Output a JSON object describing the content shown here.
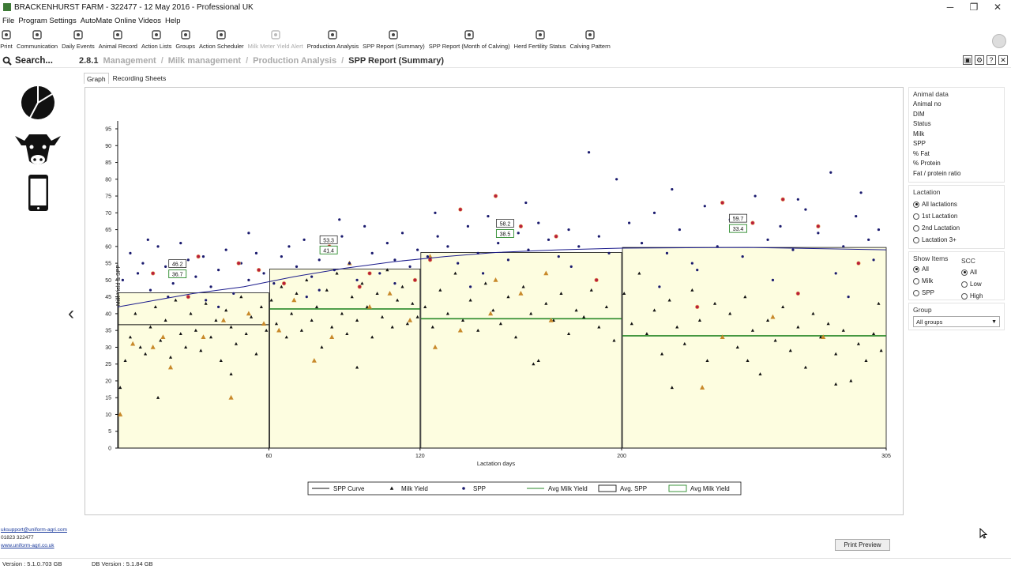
{
  "window": {
    "title": "BRACKENHURST FARM - 322477 - 12 May 2016 - Professional UK",
    "minimize": "─",
    "restore": "❐",
    "close": "✕"
  },
  "menu": [
    "File",
    "Program Settings",
    "AutoMate Online Videos",
    "Help"
  ],
  "toolbar": [
    {
      "label": "Print",
      "icon": "printer-icon",
      "disabled": false
    },
    {
      "label": "Communication",
      "icon": "antenna-icon",
      "disabled": false
    },
    {
      "label": "Daily Events",
      "icon": "monitor-icon",
      "disabled": false
    },
    {
      "label": "Animal Record",
      "icon": "cow-icon",
      "disabled": false
    },
    {
      "label": "Action Lists",
      "icon": "alert-icon",
      "disabled": false
    },
    {
      "label": "Groups",
      "icon": "group-icon",
      "disabled": false
    },
    {
      "label": "Action Scheduler",
      "icon": "stopwatch-icon",
      "disabled": false
    },
    {
      "label": "Milk Meter Yield Alert",
      "icon": "meter-icon",
      "disabled": true
    },
    {
      "label": "Production Analysis",
      "icon": "analysis-icon",
      "disabled": false
    },
    {
      "label": "SPP Report (Summary)",
      "icon": "report-icon",
      "disabled": false
    },
    {
      "label": "SPP Report (Month of Calving)",
      "icon": "report-month-icon",
      "disabled": false
    },
    {
      "label": "Herd Fertility Status",
      "icon": "fertility-icon",
      "disabled": false
    },
    {
      "label": "Calving Pattern",
      "icon": "calving-icon",
      "disabled": false
    }
  ],
  "search": {
    "label": "Search..."
  },
  "breadcrumb": {
    "number": "2.8.1",
    "items": [
      "Management",
      "Milk management",
      "Production Analysis",
      "SPP Report (Summary)"
    ]
  },
  "tabs": [
    {
      "label": "Graph",
      "active": true
    },
    {
      "label": "Recording Sheets",
      "active": false
    }
  ],
  "right_panel": {
    "animal_data": {
      "title": "Animal data",
      "fields": [
        "Animal no",
        "DIM",
        "Status",
        "Milk",
        "SPP",
        "% Fat",
        "% Protein",
        "Fat / protein ratio"
      ]
    },
    "lactation": {
      "title": "Lactation",
      "options": [
        "All lactations",
        "1st Lactation",
        "2nd Lactation",
        "Lactation 3+"
      ],
      "selected": 0
    },
    "show_items": {
      "title": "Show Items",
      "options": [
        "All",
        "Milk",
        "SPP"
      ],
      "selected": 0
    },
    "scc": {
      "title": "SCC",
      "options": [
        "All",
        "Low",
        "High"
      ],
      "selected": 0
    },
    "group": {
      "title": "Group",
      "value": "All groups"
    }
  },
  "footer": {
    "email": "uksupport@uniform-agri.com",
    "phone": "01823 322477",
    "web": "www.uniform-agri.co.uk"
  },
  "status": {
    "version": "Version : 5.1.0.703 GB",
    "db_version": "DB Version : 5.1.84 GB"
  },
  "print_preview": "Print Preview",
  "colors": {
    "fill": "#fdfde0",
    "spp_curve": "#1c1c8c",
    "avg_milk": "#2a8a2a",
    "spp_dot": "#1a1a6e",
    "spp_high": "#b81e3c",
    "milk_tri": "#111111",
    "milk_tri_high": "#c8892a"
  },
  "chart_data": {
    "type": "scatter",
    "xlabel": "Lactation days",
    "ylabel": "Milk Yield & SPP",
    "xlim": [
      0,
      305
    ],
    "ylim": [
      0,
      95
    ],
    "x_ticks": [
      60,
      120,
      200,
      305
    ],
    "y_ticks": [
      0,
      5,
      10,
      15,
      20,
      25,
      30,
      35,
      40,
      45,
      50,
      55,
      60,
      65,
      70,
      75,
      80,
      85,
      90,
      95
    ],
    "periods": [
      {
        "start": 0,
        "end": 60,
        "avg_spp": 46.2,
        "avg_milk": 36.7,
        "avg_spp_label": "46.2",
        "avg_milk_label": "36.7"
      },
      {
        "start": 60,
        "end": 120,
        "avg_spp": 53.3,
        "avg_milk": 41.4,
        "avg_spp_label": "53.3",
        "avg_milk_label": "41.4"
      },
      {
        "start": 120,
        "end": 200,
        "avg_spp": 58.2,
        "avg_milk": 38.5,
        "avg_spp_label": "58.2",
        "avg_milk_label": "38.5"
      },
      {
        "start": 200,
        "end": 305,
        "avg_spp": 59.7,
        "avg_milk": 33.4,
        "avg_spp_label": "59.7",
        "avg_milk_label": "33.4"
      }
    ],
    "spp_curve": [
      [
        0,
        42
      ],
      [
        15,
        44
      ],
      [
        30,
        46
      ],
      [
        50,
        48
      ],
      [
        70,
        51
      ],
      [
        90,
        53.5
      ],
      [
        110,
        55.5
      ],
      [
        130,
        57
      ],
      [
        150,
        58.2
      ],
      [
        175,
        59
      ],
      [
        200,
        59.5
      ],
      [
        250,
        59.7
      ],
      [
        305,
        59
      ]
    ],
    "legend": [
      "SPP Curve",
      "Milk Yield",
      "SPP",
      "Avg Milk Yield",
      "Avg. SPP",
      "Avg Milk Yield"
    ],
    "spp_points": [
      [
        2,
        50
      ],
      [
        5,
        58
      ],
      [
        8,
        52
      ],
      [
        10,
        55
      ],
      [
        13,
        47
      ],
      [
        16,
        60
      ],
      [
        19,
        54
      ],
      [
        22,
        49
      ],
      [
        25,
        61
      ],
      [
        28,
        56
      ],
      [
        31,
        51
      ],
      [
        34,
        57
      ],
      [
        37,
        48
      ],
      [
        40,
        53
      ],
      [
        43,
        59
      ],
      [
        46,
        46
      ],
      [
        49,
        55
      ],
      [
        52,
        50
      ],
      [
        55,
        58
      ],
      [
        58,
        52
      ],
      [
        62,
        49
      ],
      [
        65,
        57
      ],
      [
        68,
        60
      ],
      [
        71,
        54
      ],
      [
        74,
        62
      ],
      [
        77,
        51
      ],
      [
        80,
        56
      ],
      [
        83,
        59
      ],
      [
        86,
        53
      ],
      [
        89,
        63
      ],
      [
        92,
        55
      ],
      [
        95,
        50
      ],
      [
        98,
        66
      ],
      [
        101,
        58
      ],
      [
        104,
        52
      ],
      [
        107,
        61
      ],
      [
        110,
        56
      ],
      [
        113,
        64
      ],
      [
        116,
        54
      ],
      [
        119,
        59
      ],
      [
        123,
        57
      ],
      [
        127,
        63
      ],
      [
        131,
        60
      ],
      [
        135,
        55
      ],
      [
        139,
        66
      ],
      [
        143,
        58
      ],
      [
        147,
        69
      ],
      [
        151,
        61
      ],
      [
        155,
        56
      ],
      [
        159,
        64
      ],
      [
        163,
        59
      ],
      [
        167,
        67
      ],
      [
        171,
        62
      ],
      [
        175,
        57
      ],
      [
        179,
        65
      ],
      [
        183,
        60
      ],
      [
        187,
        88
      ],
      [
        191,
        63
      ],
      [
        195,
        58
      ],
      [
        198,
        80
      ],
      [
        203,
        67
      ],
      [
        208,
        61
      ],
      [
        213,
        70
      ],
      [
        218,
        58
      ],
      [
        223,
        65
      ],
      [
        228,
        55
      ],
      [
        233,
        72
      ],
      [
        238,
        60
      ],
      [
        243,
        68
      ],
      [
        248,
        57
      ],
      [
        253,
        75
      ],
      [
        258,
        62
      ],
      [
        263,
        66
      ],
      [
        268,
        59
      ],
      [
        273,
        71
      ],
      [
        278,
        64
      ],
      [
        283,
        82
      ],
      [
        288,
        60
      ],
      [
        293,
        69
      ],
      [
        298,
        62
      ],
      [
        302,
        65
      ],
      [
        20,
        45
      ],
      [
        40,
        42
      ],
      [
        80,
        47
      ],
      [
        110,
        49
      ],
      [
        145,
        52
      ],
      [
        180,
        54
      ],
      [
        215,
        48
      ],
      [
        260,
        50
      ],
      [
        290,
        45
      ],
      [
        300,
        56
      ],
      [
        12,
        62
      ],
      [
        52,
        64
      ],
      [
        88,
        68
      ],
      [
        126,
        70
      ],
      [
        162,
        73
      ],
      [
        220,
        77
      ],
      [
        270,
        74
      ],
      [
        295,
        76
      ],
      [
        35,
        44
      ],
      [
        75,
        45
      ],
      [
        140,
        48
      ],
      [
        230,
        53
      ],
      [
        285,
        52
      ]
    ],
    "spp_high_points": [
      [
        14,
        52
      ],
      [
        32,
        57
      ],
      [
        48,
        55
      ],
      [
        66,
        49
      ],
      [
        84,
        60
      ],
      [
        100,
        52
      ],
      [
        118,
        50
      ],
      [
        136,
        71
      ],
      [
        150,
        75
      ],
      [
        160,
        66
      ],
      [
        174,
        63
      ],
      [
        190,
        50
      ],
      [
        240,
        73
      ],
      [
        264,
        74
      ],
      [
        252,
        67
      ],
      [
        278,
        66
      ],
      [
        294,
        55
      ],
      [
        28,
        45
      ],
      [
        56,
        53
      ],
      [
        96,
        48
      ],
      [
        124,
        56
      ],
      [
        230,
        42
      ],
      [
        270,
        46
      ]
    ],
    "milk_points": [
      [
        1,
        18
      ],
      [
        3,
        26
      ],
      [
        5,
        33
      ],
      [
        7,
        40
      ],
      [
        9,
        30
      ],
      [
        11,
        28
      ],
      [
        13,
        36
      ],
      [
        15,
        42
      ],
      [
        17,
        32
      ],
      [
        19,
        38
      ],
      [
        21,
        27
      ],
      [
        23,
        44
      ],
      [
        25,
        34
      ],
      [
        27,
        30
      ],
      [
        29,
        40
      ],
      [
        31,
        35
      ],
      [
        33,
        29
      ],
      [
        35,
        43
      ],
      [
        37,
        33
      ],
      [
        39,
        38
      ],
      [
        41,
        26
      ],
      [
        43,
        41
      ],
      [
        45,
        36
      ],
      [
        47,
        31
      ],
      [
        49,
        45
      ],
      [
        51,
        34
      ],
      [
        53,
        39
      ],
      [
        55,
        28
      ],
      [
        57,
        42
      ],
      [
        59,
        35
      ],
      [
        61,
        44
      ],
      [
        63,
        37
      ],
      [
        65,
        48
      ],
      [
        67,
        33
      ],
      [
        69,
        40
      ],
      [
        71,
        46
      ],
      [
        73,
        35
      ],
      [
        75,
        50
      ],
      [
        77,
        38
      ],
      [
        79,
        42
      ],
      [
        81,
        30
      ],
      [
        83,
        47
      ],
      [
        85,
        36
      ],
      [
        87,
        52
      ],
      [
        89,
        40
      ],
      [
        91,
        34
      ],
      [
        93,
        45
      ],
      [
        95,
        38
      ],
      [
        97,
        49
      ],
      [
        99,
        42
      ],
      [
        101,
        33
      ],
      [
        103,
        46
      ],
      [
        105,
        39
      ],
      [
        107,
        53
      ],
      [
        109,
        36
      ],
      [
        111,
        44
      ],
      [
        113,
        48
      ],
      [
        115,
        37
      ],
      [
        117,
        43
      ],
      [
        119,
        39
      ],
      [
        122,
        42
      ],
      [
        125,
        36
      ],
      [
        128,
        47
      ],
      [
        131,
        40
      ],
      [
        134,
        52
      ],
      [
        137,
        38
      ],
      [
        140,
        44
      ],
      [
        143,
        35
      ],
      [
        146,
        49
      ],
      [
        149,
        41
      ],
      [
        152,
        37
      ],
      [
        155,
        45
      ],
      [
        158,
        33
      ],
      [
        161,
        48
      ],
      [
        164,
        40
      ],
      [
        167,
        26
      ],
      [
        170,
        43
      ],
      [
        173,
        38
      ],
      [
        176,
        46
      ],
      [
        179,
        34
      ],
      [
        182,
        41
      ],
      [
        185,
        39
      ],
      [
        188,
        47
      ],
      [
        191,
        36
      ],
      [
        194,
        42
      ],
      [
        197,
        32
      ],
      [
        201,
        46
      ],
      [
        204,
        37
      ],
      [
        207,
        52
      ],
      [
        210,
        34
      ],
      [
        213,
        41
      ],
      [
        216,
        28
      ],
      [
        219,
        44
      ],
      [
        222,
        36
      ],
      [
        225,
        31
      ],
      [
        228,
        47
      ],
      [
        231,
        38
      ],
      [
        234,
        26
      ],
      [
        237,
        43
      ],
      [
        240,
        33
      ],
      [
        243,
        40
      ],
      [
        246,
        30
      ],
      [
        249,
        45
      ],
      [
        252,
        35
      ],
      [
        255,
        22
      ],
      [
        258,
        38
      ],
      [
        261,
        32
      ],
      [
        264,
        42
      ],
      [
        267,
        29
      ],
      [
        270,
        36
      ],
      [
        273,
        24
      ],
      [
        276,
        40
      ],
      [
        279,
        33
      ],
      [
        282,
        37
      ],
      [
        285,
        28
      ],
      [
        288,
        35
      ],
      [
        291,
        20
      ],
      [
        294,
        31
      ],
      [
        297,
        26
      ],
      [
        300,
        34
      ],
      [
        303,
        29
      ],
      [
        16,
        15
      ],
      [
        45,
        22
      ],
      [
        95,
        24
      ],
      [
        165,
        25
      ],
      [
        220,
        18
      ],
      [
        250,
        26
      ],
      [
        285,
        19
      ],
      [
        302,
        43
      ]
    ],
    "milk_high_points": [
      [
        1,
        10
      ],
      [
        6,
        31
      ],
      [
        14,
        30
      ],
      [
        21,
        24
      ],
      [
        34,
        33
      ],
      [
        42,
        38
      ],
      [
        52,
        40
      ],
      [
        58,
        37
      ],
      [
        70,
        44
      ],
      [
        78,
        26
      ],
      [
        85,
        33
      ],
      [
        100,
        42
      ],
      [
        108,
        46
      ],
      [
        116,
        38
      ],
      [
        126,
        30
      ],
      [
        136,
        35
      ],
      [
        148,
        40
      ],
      [
        160,
        46
      ],
      [
        172,
        38
      ],
      [
        240,
        33
      ],
      [
        260,
        39
      ],
      [
        280,
        33
      ],
      [
        45,
        15
      ],
      [
        232,
        18
      ],
      [
        18,
        33
      ],
      [
        64,
        35
      ],
      [
        92,
        55
      ],
      [
        124,
        57
      ],
      [
        150,
        50
      ],
      [
        170,
        52
      ]
    ]
  }
}
